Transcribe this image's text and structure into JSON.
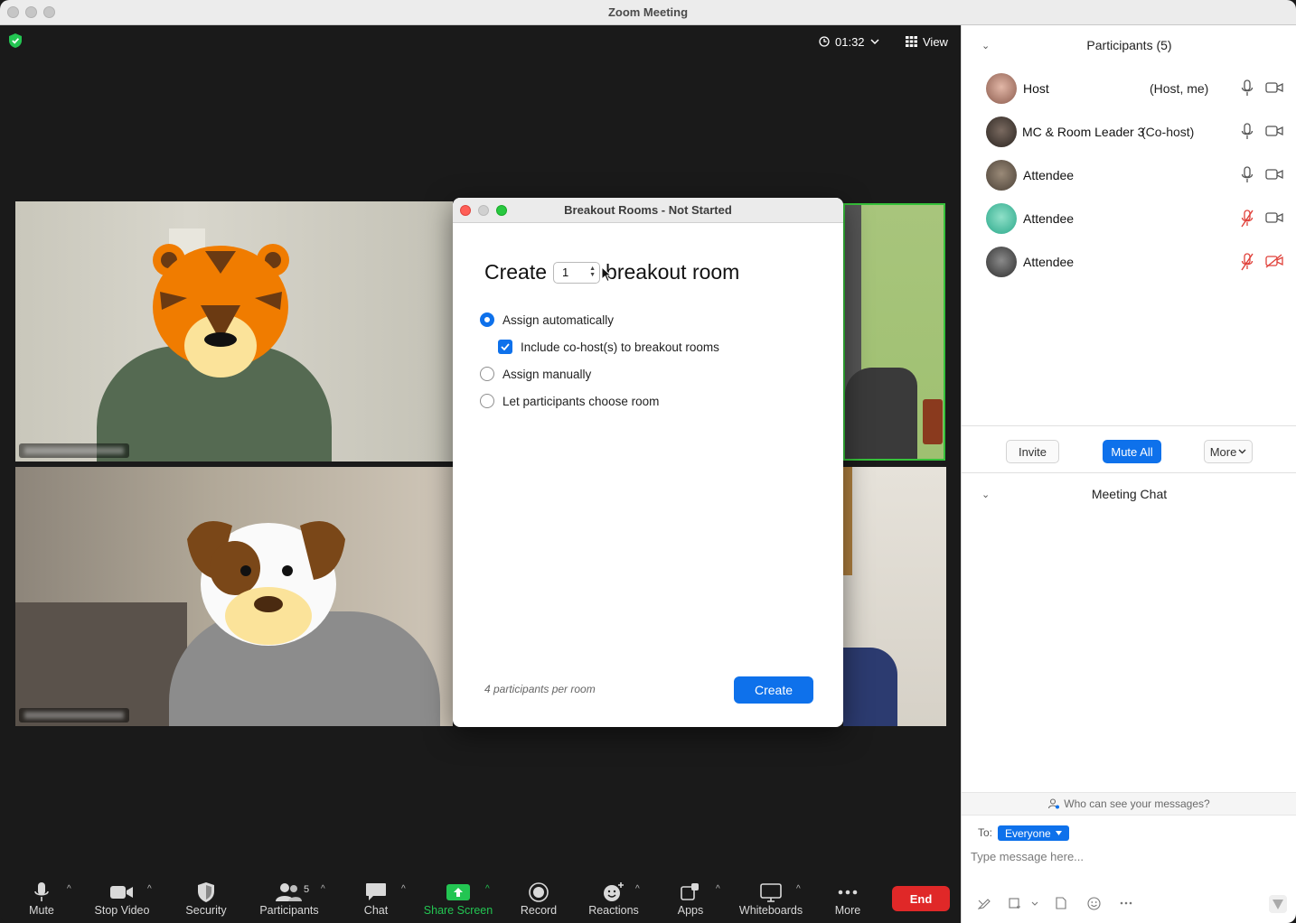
{
  "window": {
    "title": "Zoom Meeting"
  },
  "top_bar": {
    "timer": "01:32",
    "view_label": "View"
  },
  "toolbar": {
    "mute": "Mute",
    "stop_video": "Stop Video",
    "security": "Security",
    "participants": "Participants",
    "participants_count": "5",
    "chat": "Chat",
    "share_screen": "Share Screen",
    "record": "Record",
    "reactions": "Reactions",
    "apps": "Apps",
    "whiteboards": "Whiteboards",
    "more": "More",
    "end": "End"
  },
  "breakout_dialog": {
    "title": "Breakout Rooms - Not Started",
    "create_prefix": "Create",
    "room_count": "1",
    "create_suffix": "breakout room",
    "options": [
      {
        "label": "Assign automatically",
        "selected": true
      },
      {
        "label": "Include co-host(s) to breakout rooms",
        "checked": true
      },
      {
        "label": "Assign manually",
        "selected": false
      },
      {
        "label": "Let participants choose room",
        "selected": false
      }
    ],
    "per_room": "4 participants per room",
    "create_button": "Create"
  },
  "participants_panel": {
    "header": "Participants (5)",
    "participants": [
      {
        "name": "Host",
        "role": "(Host, me)",
        "mic": "on",
        "video": "on"
      },
      {
        "name": "MC & Room Leader 3",
        "role": "(Co-host)",
        "mic": "on",
        "video": "on"
      },
      {
        "name": "Attendee",
        "role": "",
        "mic": "on",
        "video": "on"
      },
      {
        "name": "Attendee",
        "role": "",
        "mic": "muted",
        "video": "on"
      },
      {
        "name": "Attendee",
        "role": "",
        "mic": "muted",
        "video": "off"
      }
    ],
    "invite": "Invite",
    "mute_all": "Mute All",
    "more": "More"
  },
  "chat_panel": {
    "header": "Meeting Chat",
    "who_can_see": "Who can see your messages?",
    "to_label": "To:",
    "recipient": "Everyone",
    "placeholder": "Type message here..."
  },
  "colors": {
    "accent": "#0e71eb",
    "end": "#e02828",
    "muted_icon": "#e0413a",
    "share_green": "#23c552",
    "active_speaker": "#36c13a"
  }
}
